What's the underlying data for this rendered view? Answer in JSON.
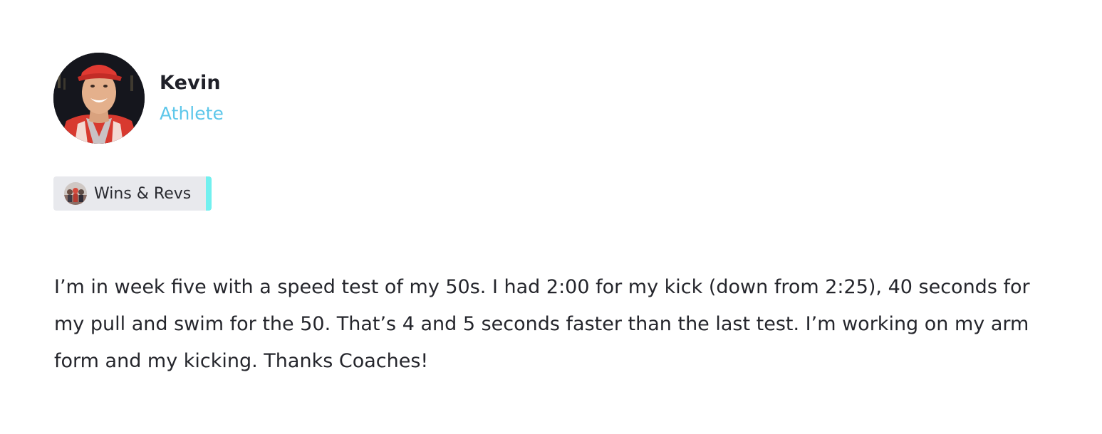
{
  "author": {
    "name": "Kevin",
    "role": "Athlete",
    "role_color": "#5ec7ea",
    "avatar_icon": "athlete-photo"
  },
  "space": {
    "label": "Wins & Revs",
    "icon": "group-photo-icon",
    "accent_color": "#72f0ef",
    "background_color": "#e8e9ed"
  },
  "post": {
    "body": "I’m in week five with a speed test of my 50s. I had 2:00 for my kick (down from 2:25), 40 seconds for my pull and swim for the 50. That’s 4 and 5 seconds faster than the last test. I’m working on my arm form and my kicking. Thanks Coaches!"
  }
}
